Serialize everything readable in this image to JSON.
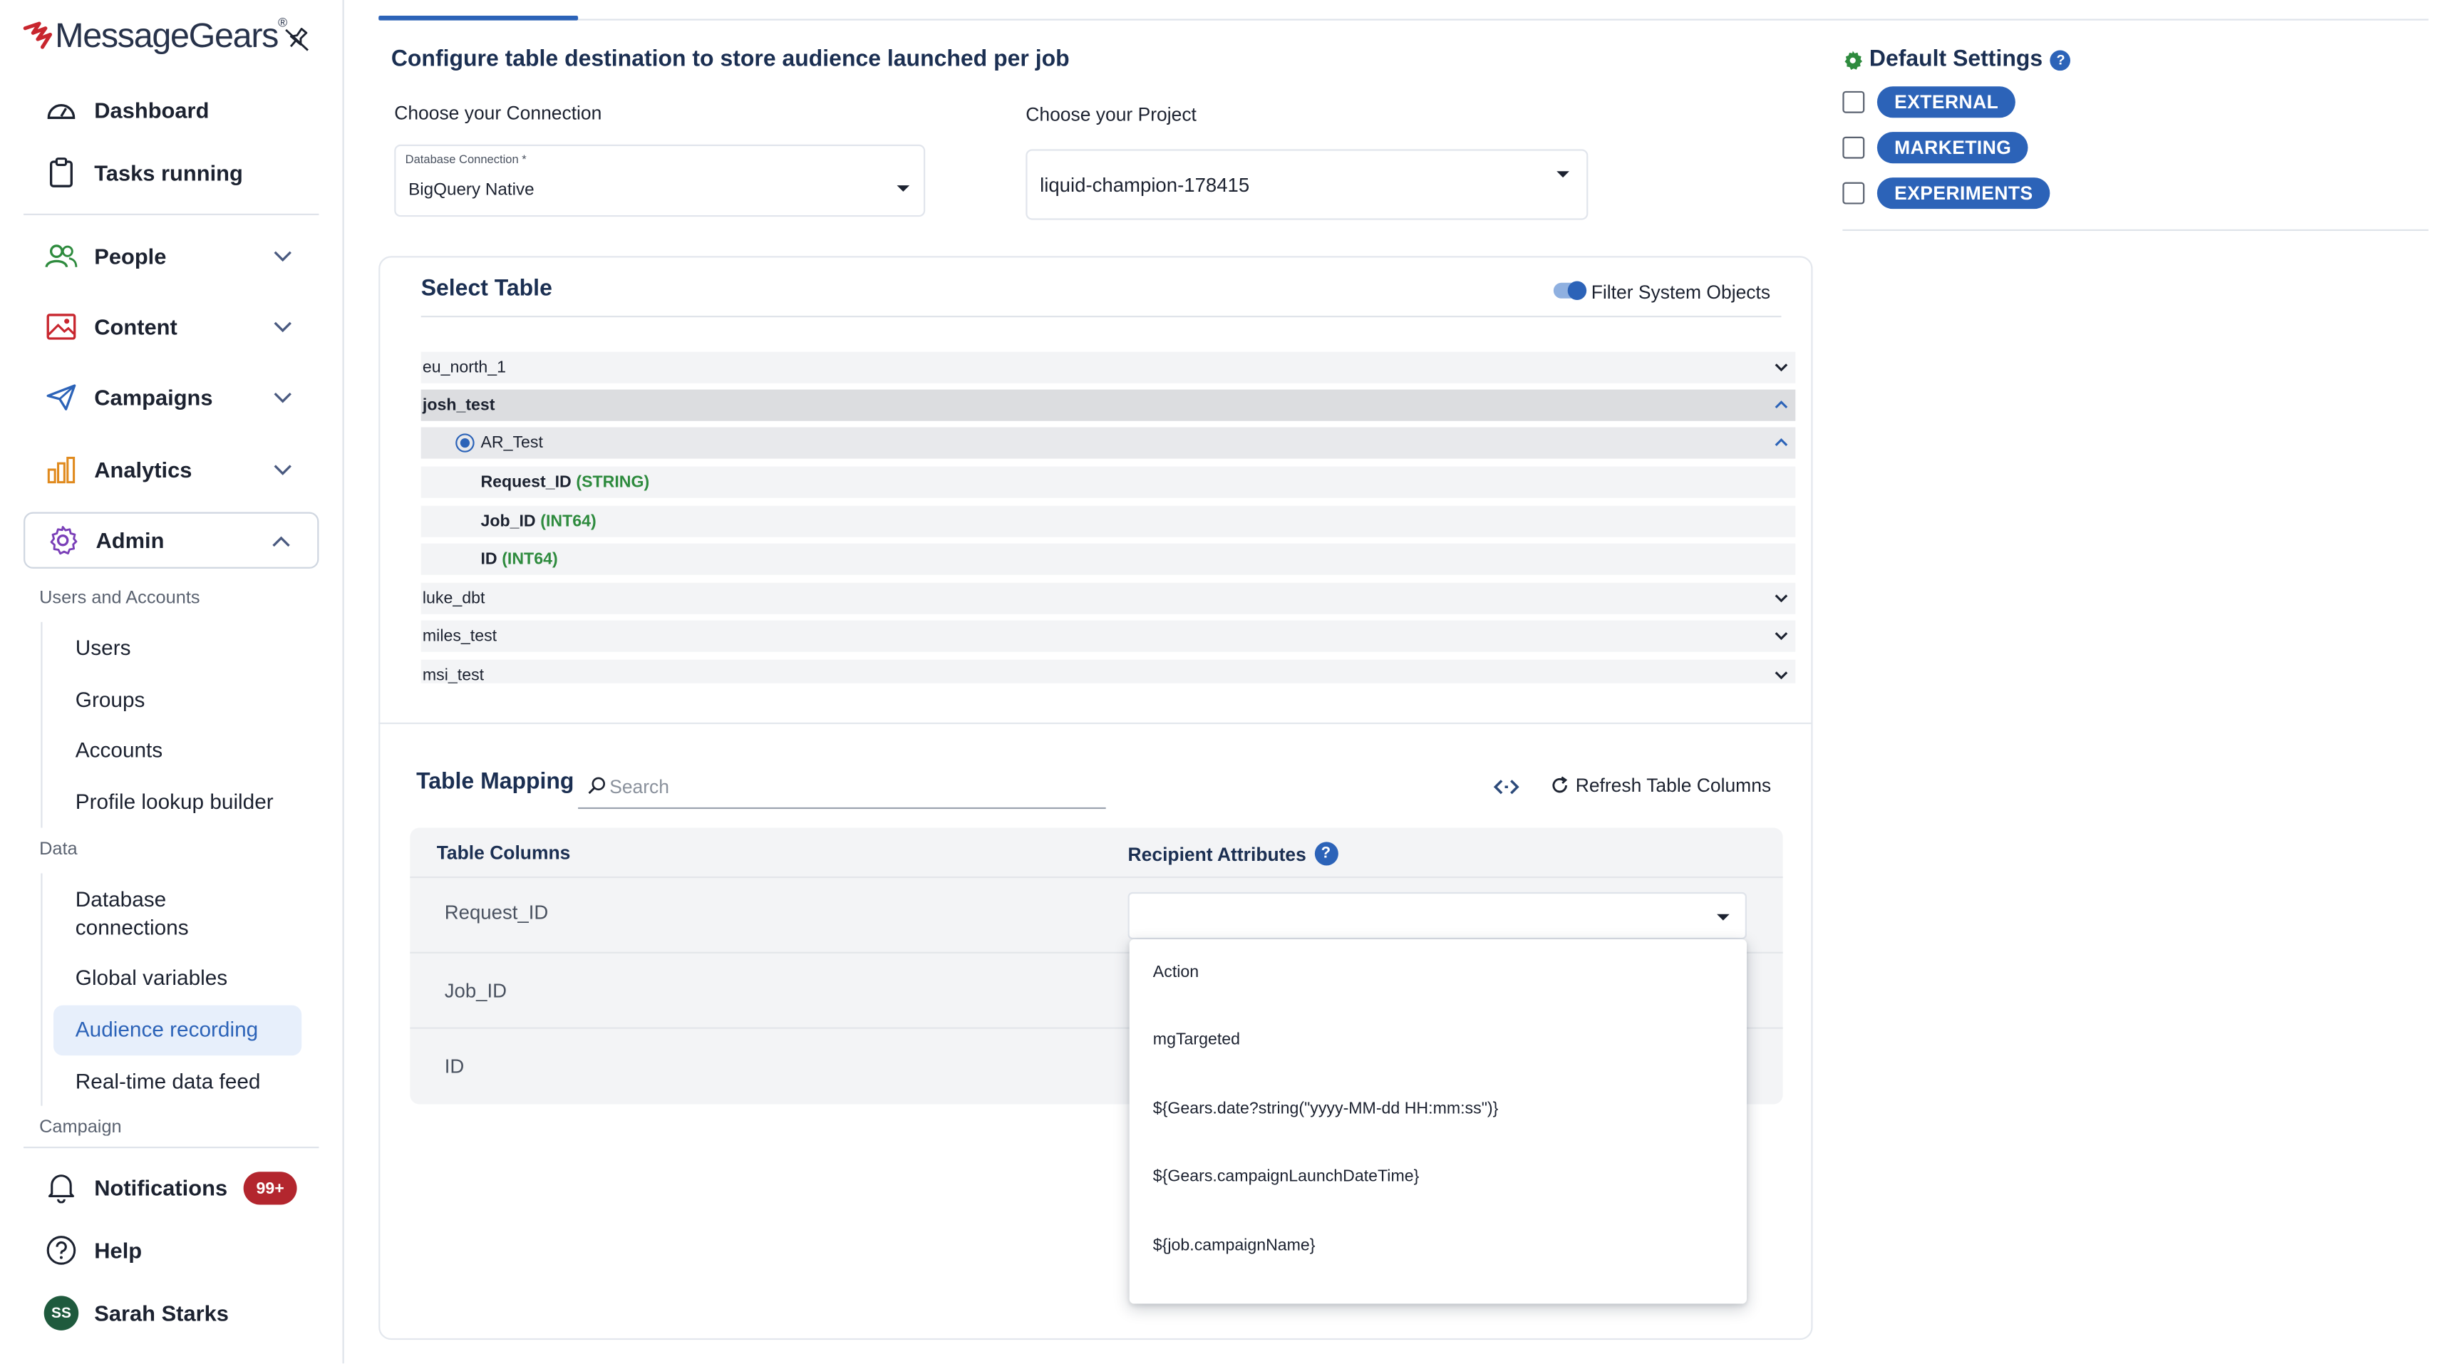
{
  "brand": {
    "name": "MessageGears"
  },
  "sidebar": {
    "nav": [
      {
        "label": "Dashboard"
      },
      {
        "label": "Tasks running"
      },
      {
        "label": "People"
      },
      {
        "label": "Content"
      },
      {
        "label": "Campaigns"
      },
      {
        "label": "Analytics"
      },
      {
        "label": "Admin"
      }
    ],
    "sections": {
      "users_accounts": "Users and Accounts",
      "data": "Data",
      "campaign": "Campaign"
    },
    "admin_items": [
      {
        "label": "Users"
      },
      {
        "label": "Groups"
      },
      {
        "label": "Accounts"
      },
      {
        "label": "Profile lookup builder"
      }
    ],
    "data_items": [
      {
        "label": "Database connections"
      },
      {
        "label": "Global variables"
      },
      {
        "label": "Audience recording"
      },
      {
        "label": "Real-time data feed"
      }
    ],
    "footer": {
      "notifications": "Notifications",
      "notifications_badge": "99+",
      "help": "Help",
      "user_name": "Sarah Starks",
      "user_initials": "SS"
    }
  },
  "main": {
    "title": "Configure table destination to store audience launched per job",
    "connection": {
      "label": "Choose your Connection",
      "field_label": "Database Connection *",
      "value": "BigQuery Native"
    },
    "project": {
      "label": "Choose your Project",
      "value": "liquid-champion-178415"
    },
    "select_table": {
      "title": "Select Table",
      "filter_label": "Filter System Objects",
      "datasets": [
        {
          "name": "eu_north_1"
        },
        {
          "name": "josh_test"
        },
        {
          "name": "luke_dbt"
        },
        {
          "name": "miles_test"
        },
        {
          "name": "msi_test"
        }
      ],
      "selected_table": "AR_Test",
      "columns": [
        {
          "name": "Request_ID",
          "type": "(STRING)"
        },
        {
          "name": "Job_ID",
          "type": "(INT64)"
        },
        {
          "name": "ID",
          "type": "(INT64)"
        }
      ]
    },
    "mapping": {
      "title": "Table Mapping",
      "search_placeholder": "Search",
      "refresh_label": "Refresh Table Columns",
      "col_table": "Table Columns",
      "col_attrs": "Recipient Attributes",
      "rows": [
        {
          "column": "Request_ID"
        },
        {
          "column": "Job_ID"
        },
        {
          "column": "ID"
        }
      ],
      "dropdown_options": [
        "Action",
        "mgTargeted",
        "${Gears.date?string(\"yyyy-MM-dd HH:mm:ss\")}",
        "${Gears.campaignLaunchDateTime}",
        "${job.campaignName}"
      ]
    }
  },
  "defaults": {
    "title": "Default Settings",
    "tags": [
      "EXTERNAL",
      "MARKETING",
      "EXPERIMENTS"
    ]
  },
  "colors": {
    "accent": "#2c63b8",
    "badge": "#b3262e",
    "type_green": "#2e8b3e",
    "brand_red": "#c8262e"
  }
}
